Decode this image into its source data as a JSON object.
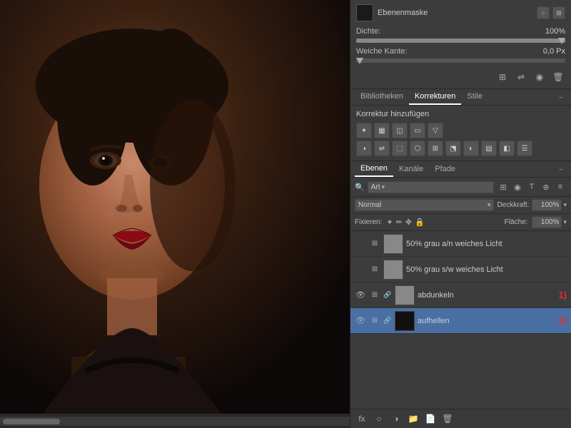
{
  "canvas": {
    "scrollbar_label": "canvas-scrollbar"
  },
  "mask_section": {
    "title": "Ebenenmaske",
    "dichte_label": "Dichte:",
    "dichte_value": "100%",
    "weiche_kante_label": "Weiche Kante:",
    "weiche_kante_value": "0,0 Px"
  },
  "tabs": {
    "items": [
      {
        "label": "Bibliotheken",
        "active": false
      },
      {
        "label": "Korrekturen",
        "active": true
      },
      {
        "label": "Stile",
        "active": false
      }
    ]
  },
  "correction": {
    "title": "Korrektur hinzufügen",
    "icons": [
      "☀",
      "▦",
      "◫",
      "▭",
      "▽",
      "◑",
      "⇌",
      "⬚",
      "⬡",
      "⊞",
      "⬔",
      "◐",
      "▤",
      "◧",
      "☰",
      "⊕"
    ]
  },
  "layers": {
    "tabs": [
      {
        "label": "Ebenen",
        "active": true
      },
      {
        "label": "Kanäle",
        "active": false
      },
      {
        "label": "Pfade",
        "active": false
      }
    ],
    "search_placeholder": "Art",
    "blend_mode": "Normal",
    "deckkraft_label": "Deckkraft:",
    "deckkraft_value": "100%",
    "fixieren_label": "Fixieren:",
    "flaeche_label": "Fläche:",
    "flaeche_value": "100%",
    "items": [
      {
        "id": 1,
        "visible": false,
        "name": "50% grau a/n weiches Licht",
        "selected": false,
        "has_eye": false,
        "has_type": true,
        "thumb_type": "gray"
      },
      {
        "id": 2,
        "visible": false,
        "name": "50% grau s/w weiches Licht",
        "selected": false,
        "has_eye": false,
        "has_type": true,
        "thumb_type": "gray"
      },
      {
        "id": 3,
        "visible": true,
        "name": "abdunkeln",
        "selected": false,
        "has_eye": true,
        "has_type": true,
        "badge": "1)",
        "thumb_type": "gray"
      },
      {
        "id": 4,
        "visible": true,
        "name": "aufhellen",
        "selected": true,
        "has_eye": true,
        "has_type": true,
        "badge": "2)",
        "thumb_type": "black"
      }
    ]
  }
}
